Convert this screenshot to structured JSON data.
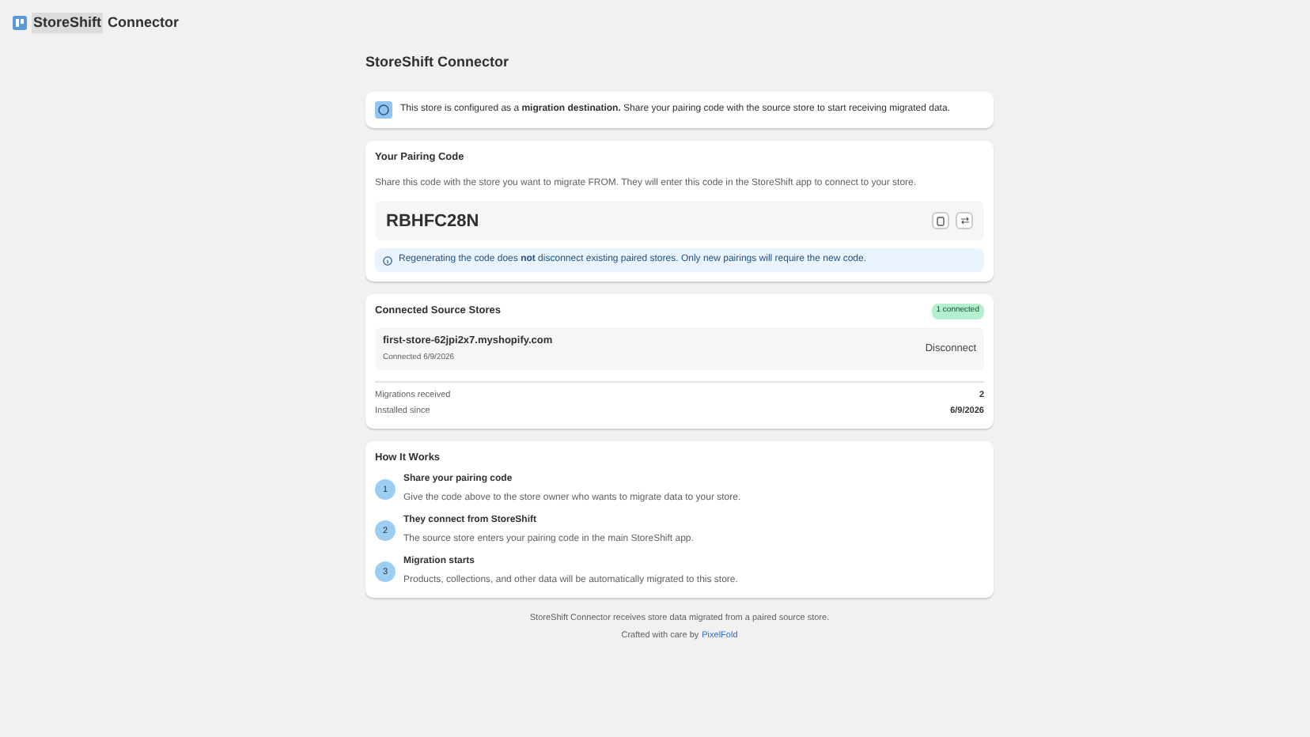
{
  "app_header": {
    "title_parts": [
      "StoreShift",
      "Connector"
    ]
  },
  "page_title": "StoreShift Connector",
  "banner": {
    "text": "This store is configured as a **migration destination.** Share your pairing code with the source store to start receiving migrated data."
  },
  "pairing": {
    "heading": "Your Pairing Code",
    "description": "Share this code with the store you want to migrate FROM. They will enter this code in the StoreShift app to connect to your store.",
    "code": "RBHFC28N",
    "note": "Regenerating the code does **not** disconnect existing paired stores. Only new pairings will require the new code."
  },
  "connected": {
    "heading": "Connected Source Stores",
    "badge": "1 connected",
    "stores": [
      {
        "domain": "first-store-62jpi2x7.myshopify.com",
        "date": "Connected 6/9/2026",
        "action": "Disconnect"
      }
    ],
    "stats": [
      {
        "label": "Migrations received",
        "value": "2"
      },
      {
        "label": "Installed since",
        "value": "6/9/2026"
      }
    ]
  },
  "how": {
    "heading": "How It Works",
    "steps": [
      {
        "number": "1",
        "title": "Share your pairing code",
        "text": "Give the code above to the store owner who wants to migrate data to your store."
      },
      {
        "number": "2",
        "title": "They connect from StoreShift",
        "text": "The source store enters your pairing code in the main StoreShift app."
      },
      {
        "number": "3",
        "title": "Migration starts",
        "text": "Products, collections, and other data will be automatically migrated to this store."
      }
    ]
  },
  "footer": {
    "text": "StoreShift Connector receives store data migrated from a paired source store.",
    "credit": "Crafted with care by",
    "link": "PixelFold"
  }
}
